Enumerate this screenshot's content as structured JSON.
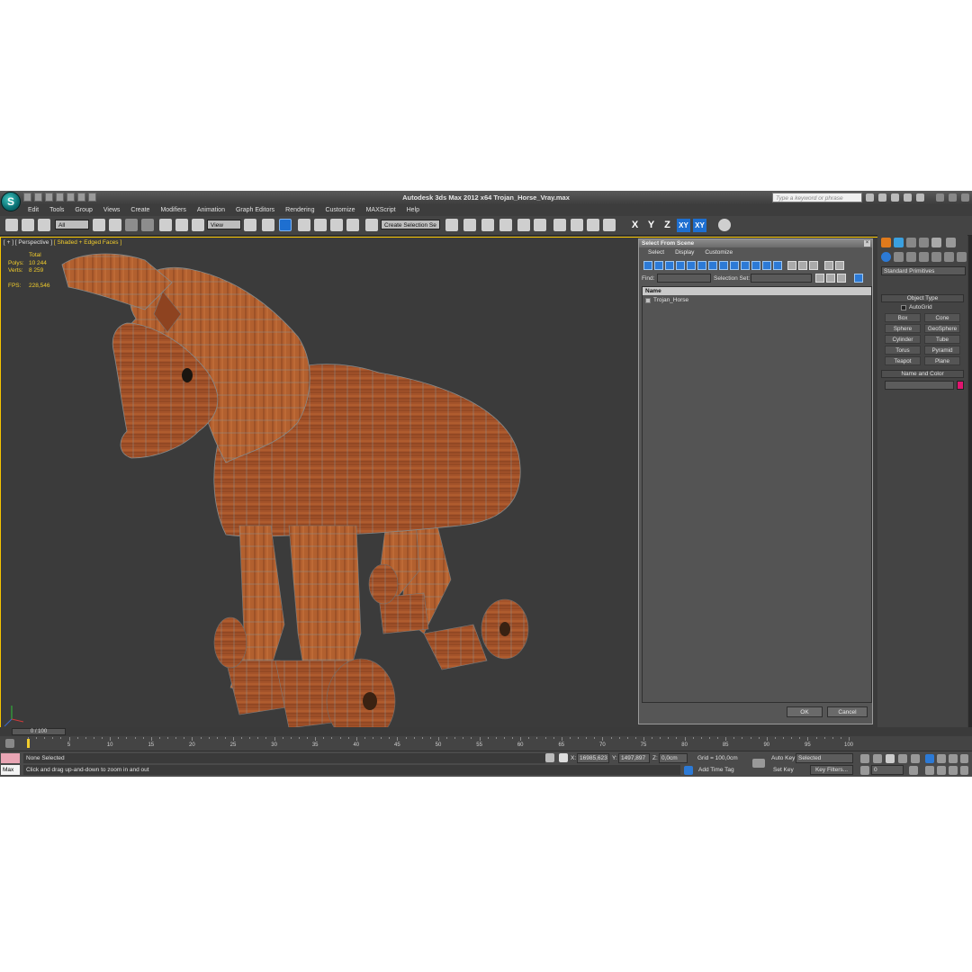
{
  "titlebar": {
    "title": "Autodesk 3ds Max  2012 x64     Trojan_Horse_Vray.max",
    "search_placeholder": "Type a keyword or phrase"
  },
  "menubar": [
    "Edit",
    "Tools",
    "Group",
    "Views",
    "Create",
    "Modifiers",
    "Animation",
    "Graph Editors",
    "Rendering",
    "Customize",
    "MAXScript",
    "Help"
  ],
  "toolbar": {
    "filter_value": "All",
    "ref_coord_value": "View",
    "selection_set_placeholder": "Create Selection Se",
    "axis_x": "X",
    "axis_y": "Y",
    "axis_z": "Z",
    "axis_xy": "XY",
    "axis_xy2": "XY"
  },
  "viewport": {
    "label_prefix": "[ + ] [ Perspective ] ",
    "label_shading": "[ Shaded + Edged Faces ]",
    "stats": {
      "total_label": "Total",
      "polys_label": "Polys:",
      "polys_value": "10 244",
      "verts_label": "Verts:",
      "verts_value": "8 259",
      "fps_label": "FPS:",
      "fps_value": "228,546"
    },
    "object_colors": {
      "wood_base": "#a5542a",
      "wood_light": "#c47438",
      "wood_dark": "#6e3216",
      "edges": "#8a8f90"
    }
  },
  "dialog": {
    "title": "Select From Scene",
    "close_icon": "close-icon",
    "menu": [
      "Select",
      "Display",
      "Customize"
    ],
    "find_label": "Find:",
    "selection_set_label": "Selection Set:",
    "list_header": "Name",
    "objects": [
      "Trojan_Horse"
    ],
    "ok_label": "OK",
    "cancel_label": "Cancel"
  },
  "command_panel": {
    "category": "Standard Primitives",
    "object_type_title": "Object Type",
    "autogrid_label": "AutoGrid",
    "primitives": [
      "Box",
      "Cone",
      "Sphere",
      "GeoSphere",
      "Cylinder",
      "Tube",
      "Torus",
      "Pyramid",
      "Teapot",
      "Plane"
    ],
    "name_color_title": "Name and Color",
    "object_color": "#e0156f"
  },
  "timeline": {
    "frame_display": "0 / 100",
    "ticks": [
      0,
      5,
      10,
      15,
      20,
      25,
      30,
      35,
      40,
      45,
      50,
      55,
      60,
      65,
      70,
      75,
      80,
      85,
      90,
      95,
      100
    ]
  },
  "statusbar": {
    "maxscript_label": "Max",
    "selection_status": "None Selected",
    "prompt": "Click and drag up-and-down to zoom in and out",
    "x_label": "X:",
    "x_value": "16985,623",
    "y_label": "Y:",
    "y_value": "1497,897",
    "z_label": "Z:",
    "z_value": "0,0cm",
    "grid_text": "Grid = 100,0cm",
    "add_time_tag": "Add Time Tag",
    "auto_key": "Auto Key",
    "set_key": "Set Key",
    "key_mode_value": "Selected",
    "key_filters": "Key Filters...",
    "current_frame": "0"
  }
}
